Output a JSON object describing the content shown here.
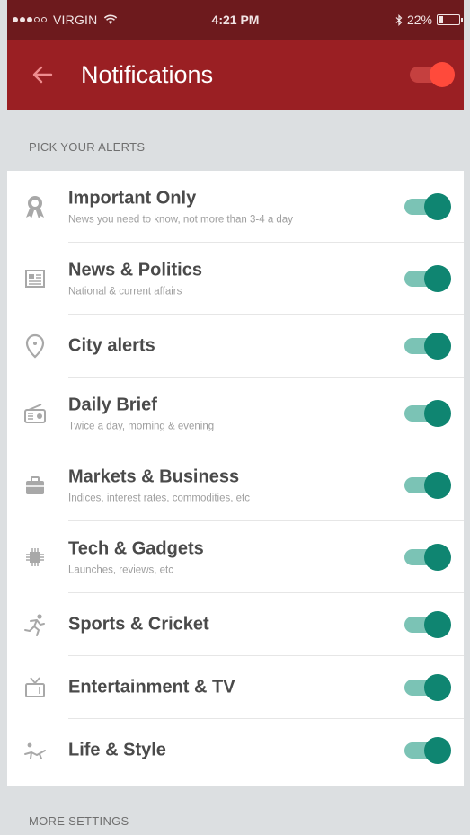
{
  "status_bar": {
    "carrier": "VIRGIN",
    "time": "4:21 PM",
    "battery": "22%",
    "battery_level": 0.22
  },
  "app_bar": {
    "title": "Notifications",
    "master_toggle_on": true
  },
  "sections": {
    "pick_alerts": "PICK YOUR ALERTS",
    "more_settings": "MORE SETTINGS"
  },
  "alerts": [
    {
      "icon": "award-icon",
      "label": "Important Only",
      "sub": "News you need to know, not more than 3-4 a day",
      "enabled": true
    },
    {
      "icon": "newspaper-icon",
      "label": "News & Politics",
      "sub": "National & current affairs",
      "enabled": true
    },
    {
      "icon": "location-pin-icon",
      "label": "City alerts",
      "sub": "",
      "enabled": true
    },
    {
      "icon": "radio-icon",
      "label": "Daily Brief",
      "sub": "Twice a day, morning & evening",
      "enabled": true
    },
    {
      "icon": "briefcase-icon",
      "label": "Markets & Business",
      "sub": "Indices, interest rates, commodities, etc",
      "enabled": true
    },
    {
      "icon": "chip-icon",
      "label": "Tech & Gadgets",
      "sub": "Launches, reviews, etc",
      "enabled": true
    },
    {
      "icon": "runner-icon",
      "label": "Sports & Cricket",
      "sub": "",
      "enabled": true
    },
    {
      "icon": "tv-icon",
      "label": "Entertainment & TV",
      "sub": "",
      "enabled": true
    },
    {
      "icon": "lounger-icon",
      "label": "Life & Style",
      "sub": "",
      "enabled": true
    }
  ],
  "colors": {
    "status_bar": "#6d1a1d",
    "app_bar": "#9a1f23",
    "accent_toggle_on": "#0f8571",
    "toggle_track_on": "#7bc3b5",
    "master_toggle_knob": "#ff4a3b",
    "background": "#dcdfe1"
  }
}
